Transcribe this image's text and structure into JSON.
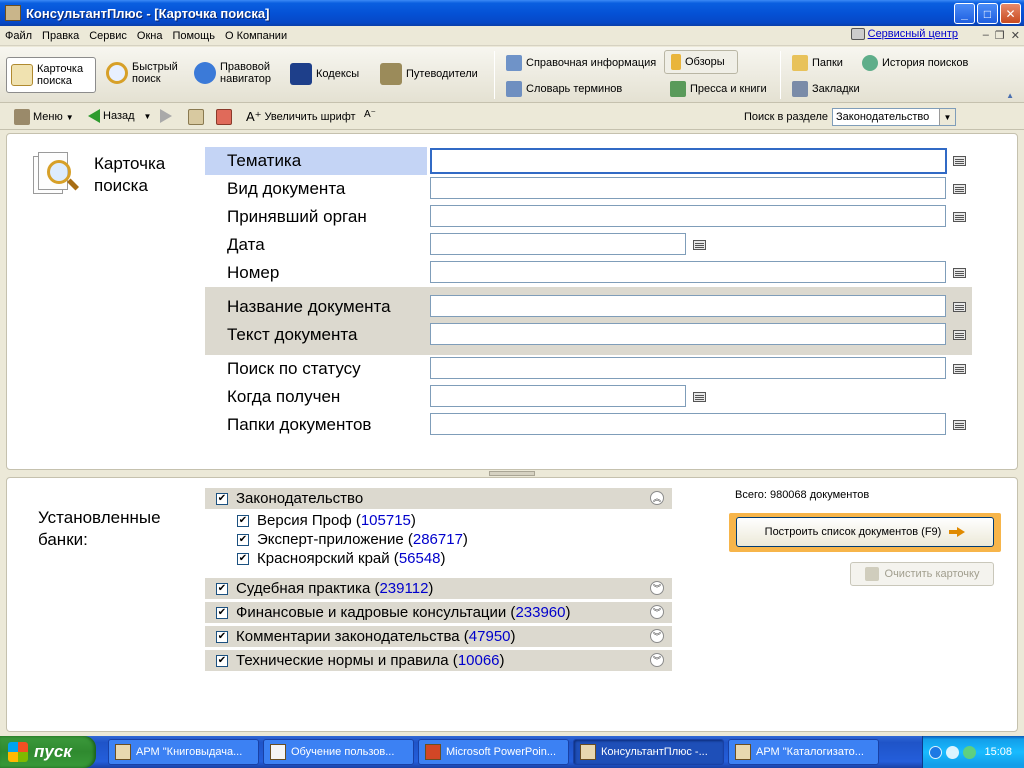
{
  "window": {
    "title": "КонсультантПлюс - [Карточка поиска]"
  },
  "menu": {
    "items": [
      "Файл",
      "Правка",
      "Сервис",
      "Окна",
      "Помощь",
      "О Компании"
    ],
    "service_center": "Сервисный центр"
  },
  "toolbar": {
    "card_search": "Карточка поиска",
    "quick_search": "Быстрый поиск",
    "legal_navigator": "Правовой навигатор",
    "codes": "Кодексы",
    "guides": "Путеводители",
    "reference_info": "Справочная информация",
    "reviews": "Обзоры",
    "glossary": "Словарь терминов",
    "press_books": "Пресса и книги",
    "folders": "Папки",
    "search_history": "История поисков",
    "bookmarks": "Закладки"
  },
  "navbar": {
    "menu": "Меню",
    "back": "Назад",
    "increase_font": "Увеличить шрифт",
    "search_in_section_label": "Поиск в разделе",
    "search_in_section_value": "Законодательство"
  },
  "card": {
    "title": "Карточка поиска",
    "fields": {
      "topic": "Тематика",
      "doc_type": "Вид документа",
      "authority": "Принявший орган",
      "date": "Дата",
      "number": "Номер",
      "doc_name": "Название документа",
      "doc_text": "Текст документа",
      "status": "Поиск по статусу",
      "received": "Когда получен",
      "folders": "Папки документов"
    }
  },
  "banks": {
    "label": "Установленные банки:",
    "total": "Всего: 980068 документов",
    "legislation": "Законодательство",
    "sub": [
      {
        "name": "Версия Проф",
        "count": "105715"
      },
      {
        "name": "Эксперт-приложение",
        "count": "286717"
      },
      {
        "name": "Красноярский край",
        "count": "56548"
      }
    ],
    "groups": [
      {
        "name": "Судебная практика",
        "count": "239112"
      },
      {
        "name": "Финансовые и кадровые консультации",
        "count": "233960"
      },
      {
        "name": "Комментарии законодательства",
        "count": "47950"
      },
      {
        "name": "Технические нормы и правила",
        "count": "10066"
      }
    ],
    "build_button": "Построить список документов (F9)",
    "clear_button": "Очистить карточку"
  },
  "taskbar": {
    "start": "пуск",
    "tasks": [
      "АРМ \"Книговыдача...",
      "Обучение пользов...",
      "Microsoft PowerPoin...",
      "КонсультантПлюс -...",
      "АРМ \"Каталогизато..."
    ],
    "clock": "15:08"
  }
}
